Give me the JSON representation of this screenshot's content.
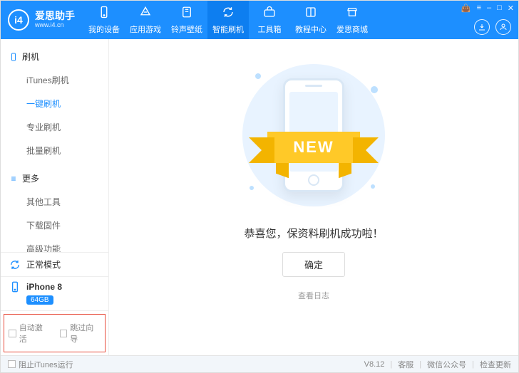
{
  "app": {
    "logo_text": "i4",
    "brand_name": "爱思助手",
    "brand_url": "www.i4.cn"
  },
  "nav": {
    "items": [
      {
        "label": "我的设备",
        "icon": "phone"
      },
      {
        "label": "应用游戏",
        "icon": "appstore"
      },
      {
        "label": "铃声壁纸",
        "icon": "music"
      },
      {
        "label": "智能刷机",
        "icon": "refresh",
        "active": true
      },
      {
        "label": "工具箱",
        "icon": "toolbox"
      },
      {
        "label": "教程中心",
        "icon": "book"
      },
      {
        "label": "爱思商城",
        "icon": "shop"
      }
    ]
  },
  "sidebar": {
    "groups": [
      {
        "title": "刷机",
        "icon": "phone-outline",
        "items": [
          {
            "label": "iTunes刷机"
          },
          {
            "label": "一键刷机",
            "active": true
          },
          {
            "label": "专业刷机"
          },
          {
            "label": "批量刷机"
          }
        ]
      },
      {
        "title": "更多",
        "icon": "menu",
        "items": [
          {
            "label": "其他工具"
          },
          {
            "label": "下载固件"
          },
          {
            "label": "高级功能"
          }
        ]
      }
    ],
    "mode": {
      "label": "正常模式"
    },
    "device": {
      "name": "iPhone 8",
      "storage": "64GB"
    },
    "checkboxes": {
      "auto_activate": "自动激活",
      "skip_wizard": "跳过向导"
    }
  },
  "main": {
    "ribbon_text": "NEW",
    "success_text": "恭喜您，保资料刷机成功啦！",
    "ok_button": "确定",
    "view_log": "查看日志"
  },
  "footer": {
    "block_itunes": "阻止iTunes运行",
    "version": "V8.12",
    "support": "客服",
    "wechat": "微信公众号",
    "check_update": "检查更新"
  }
}
